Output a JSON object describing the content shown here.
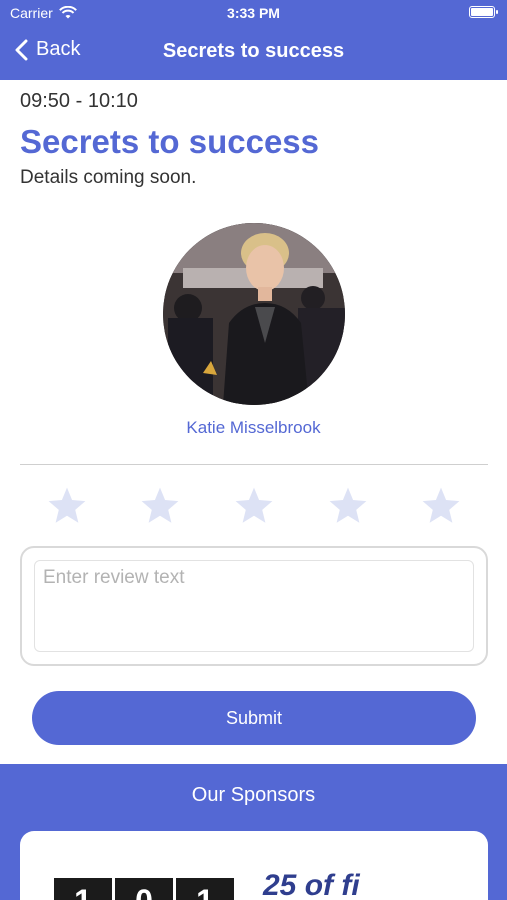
{
  "status_bar": {
    "carrier": "Carrier",
    "time": "3:33 PM"
  },
  "nav": {
    "back_label": "Back",
    "title": "Secrets to success"
  },
  "session": {
    "time_range": "09:50 - 10:10",
    "title": "Secrets to success",
    "details": "Details coming soon."
  },
  "speaker": {
    "name": "Katie Misselbrook"
  },
  "rating": {
    "stars": 5,
    "selected": 0
  },
  "review": {
    "placeholder": "Enter review text",
    "value": ""
  },
  "submit": {
    "label": "Submit"
  },
  "sponsors": {
    "title": "Our Sponsors",
    "digits": [
      "1",
      "0",
      "1"
    ],
    "brand_text": "25 of fi"
  },
  "colors": {
    "accent": "#5468d4",
    "star_empty": "#dde2f5"
  }
}
